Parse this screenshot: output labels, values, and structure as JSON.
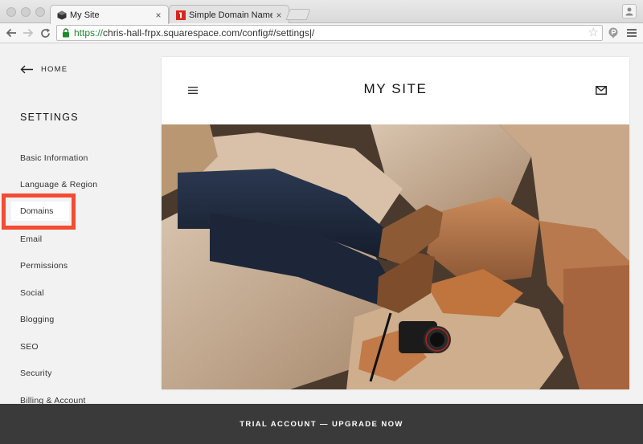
{
  "browser": {
    "tabs": [
      {
        "title": "My Site",
        "active": true
      },
      {
        "title": "Simple Domain Name Reg",
        "active": false
      }
    ],
    "close_glyph": "×",
    "url_scheme": "https://",
    "url_rest": "chris-hall-frpx.squarespace.com/config#/settings|/",
    "icons": [
      "back-icon",
      "forward-icon",
      "reload-icon",
      "lock-icon",
      "star-icon",
      "extension-icon",
      "menu-icon"
    ]
  },
  "sidebar": {
    "home_label": "HOME",
    "title": "SETTINGS",
    "items": [
      {
        "label": "Basic Information"
      },
      {
        "label": "Language & Region"
      },
      {
        "label": "Domains",
        "selected": true
      },
      {
        "label": "Email"
      },
      {
        "label": "Permissions"
      },
      {
        "label": "Social"
      },
      {
        "label": "Blogging"
      },
      {
        "label": "SEO"
      },
      {
        "label": "Security"
      },
      {
        "label": "Billing & Account"
      }
    ]
  },
  "preview": {
    "site_title": "MY SITE"
  },
  "banner": {
    "text": "TRIAL ACCOUNT — UPGRADE NOW"
  },
  "colors": {
    "highlight": "#f44b32",
    "banner_bg": "#3a3a3a",
    "url_secure": "#1e8a2e"
  }
}
